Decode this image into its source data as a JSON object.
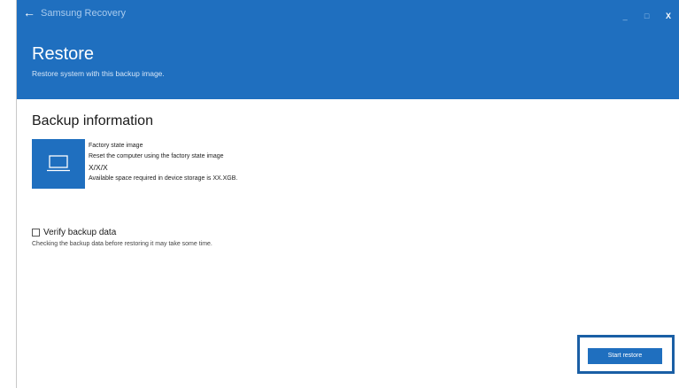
{
  "titlebar": {
    "app_title": "Samsung Recovery",
    "back_icon": "arrow-left-icon",
    "minimize_label": "_",
    "maximize_label": "□",
    "close_label": "X"
  },
  "header": {
    "title": "Restore",
    "subtitle": "Restore system with this backup image.",
    "background_color": "#1f6fbf"
  },
  "backup": {
    "section_title": "Backup information",
    "icon": "laptop-icon",
    "name": "Factory state image",
    "description": "Reset the computer using the factory state image",
    "version": "X/X/X",
    "space_required": "Available space required in device storage is XX.XGB."
  },
  "verify": {
    "checked": false,
    "label": "Verify backup data",
    "description": "Checking the backup data before restoring it may take some time."
  },
  "actions": {
    "start_restore_label": "Start restore"
  }
}
